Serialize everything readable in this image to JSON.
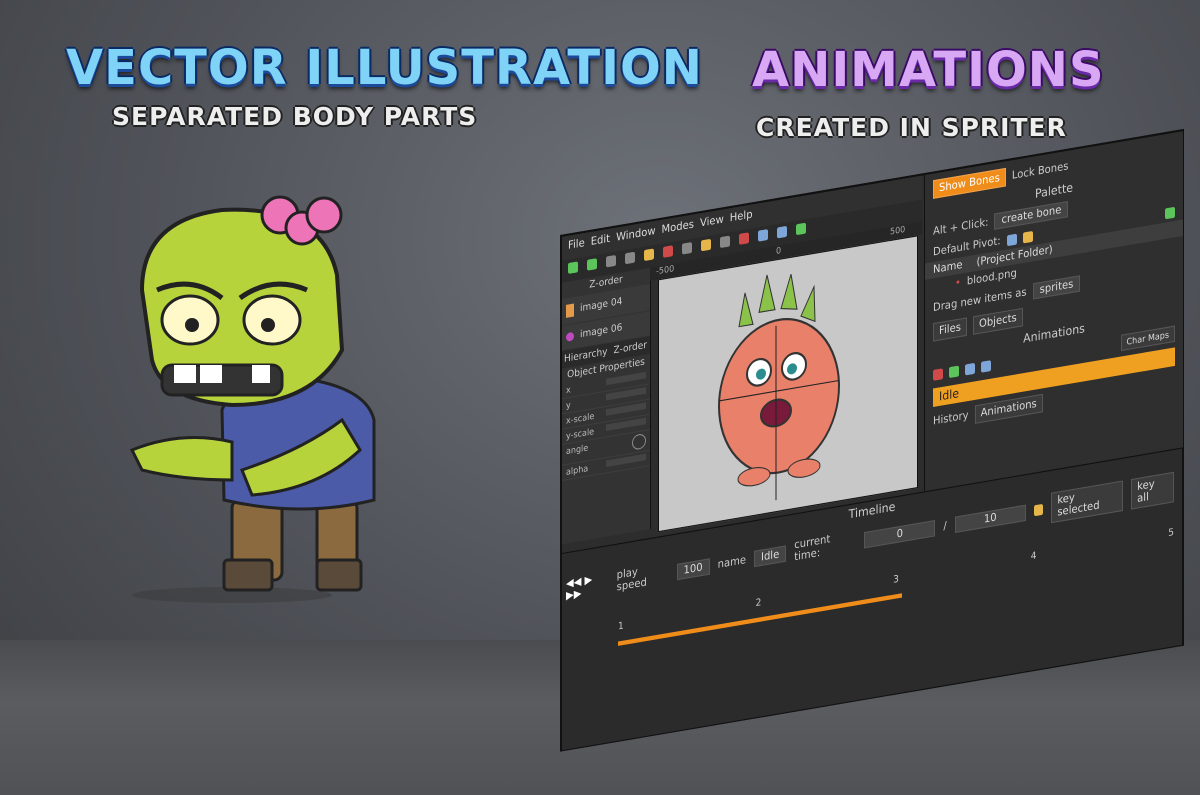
{
  "headings": {
    "left_title": "VECTOR ILLUSTRATION",
    "left_subtitle": "SEPARATED BODY PARTS",
    "right_title": "ANIMATIONS",
    "right_subtitle": "CREATED IN SPRITER"
  },
  "app": {
    "menu": [
      "File",
      "Edit",
      "Window",
      "Modes",
      "View",
      "Help"
    ],
    "zorder": {
      "header": "Z-order",
      "items": [
        "image 04",
        "image 06"
      ],
      "tabs": [
        "Hierarchy",
        "Z-order"
      ]
    },
    "object_properties": {
      "header": "Object Properties",
      "fields": [
        "x",
        "y",
        "x-scale",
        "y-scale",
        "angle",
        "alpha"
      ]
    },
    "ruler": {
      "marks": [
        "-500",
        "0",
        "500"
      ]
    },
    "right": {
      "show_bones": "Show Bones",
      "lock_bones": "Lock Bones",
      "palette_header": "Palette",
      "alt_click_label": "Alt + Click:",
      "create_bone": "create bone",
      "default_pivot": "Default Pivot:",
      "col_name": "Name",
      "col_folder": "(Project Folder)",
      "file_item": "blood.png",
      "drag_label": "Drag new items as",
      "drag_value": "sprites",
      "tabs": [
        "Files",
        "Objects"
      ],
      "animations_header": "Animations",
      "char_maps": "Char Maps",
      "anim_item": "Idle",
      "bottom_tabs": [
        "History",
        "Animations"
      ]
    },
    "timeline": {
      "header": "Timeline",
      "play_speed": "play speed",
      "play_speed_value": "100",
      "name_label": "name",
      "name_value": "Idle",
      "current_time_label": "current time:",
      "current_time": "0",
      "separator": "/",
      "total_time": "10",
      "key_selected": "key selected",
      "key_all": "key all",
      "ticks": [
        "1",
        "2",
        "3",
        "4",
        "5"
      ]
    }
  },
  "colors": {
    "accent": "#f08c1a",
    "bg": "#2d2d2d"
  }
}
